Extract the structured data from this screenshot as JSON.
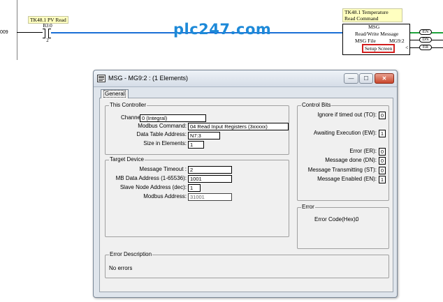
{
  "ladder": {
    "rung_number": "009",
    "input_comment": "TK48.1 PV Read",
    "input_address": "B3:0",
    "input_bit": "2",
    "msg_comment_line1": "TK48.1 Temperature",
    "msg_comment_line2": "Read Command",
    "msg_block_title": "MSG",
    "msg_row1": "Read/Write Message",
    "msg_file_label": "MSG File",
    "msg_file_value": "MG9:2",
    "setup_screen": "Setup Screen",
    "lt": "<",
    "outputs": [
      "EN",
      "DN",
      "ER"
    ]
  },
  "watermark": "plc247.com",
  "dialog": {
    "title": "MSG - MG9:2 : (1 Elements)",
    "buttons": {
      "minimize": "—",
      "maximize": "☐",
      "close": "✕"
    },
    "tab_general": "General",
    "this_controller": {
      "label": "This Controller",
      "channel_label": "Channel:",
      "channel_value": "0 (Integral)",
      "modbus_command_label": "Modbus Command:",
      "modbus_command_value": "04 Read Input Registers (3xxxxx)",
      "data_table_address_label": "Data Table Address:",
      "data_table_address_value": "N7:3",
      "size_in_elements_label": "Size in Elements:",
      "size_in_elements_value": "1"
    },
    "target_device": {
      "label": "Target Device",
      "message_timeout_label": "Message Timeout :",
      "message_timeout_value": "2",
      "mb_data_address_label": "MB Data Address (1-65536):",
      "mb_data_address_value": "1001",
      "slave_node_address_label": "Slave Node Address (dec):",
      "slave_node_address_value": "1",
      "modbus_address_label": "Modbus Address:",
      "modbus_address_value": "31001"
    },
    "control_bits": {
      "label": "Control Bits",
      "ignore_timeout_label": "Ignore if timed out (TO):",
      "ignore_timeout_value": "0",
      "awaiting_label": "Awaiting Execution (EW):",
      "awaiting_value": "1",
      "error_label": "Error (ER):",
      "error_value": "0",
      "done_label": "Message done (DN):",
      "done_value": "0",
      "transmitting_label": "Message Transmitting (ST):",
      "transmitting_value": "0",
      "enabled_label": "Message Enabled (EN):",
      "enabled_value": "1"
    },
    "error": {
      "label": "Error",
      "code_label": "Error Code(Hex):",
      "code_value": "0"
    },
    "error_description": {
      "label": "Error Description",
      "text": "No errors"
    }
  },
  "colors": {
    "watermark": "#1d89d8",
    "wire_blue": "#1a6fd6",
    "wire_green": "#1ea33b",
    "setup_box_border": "#d21d1d",
    "comment_bg": "#ffffc0"
  }
}
